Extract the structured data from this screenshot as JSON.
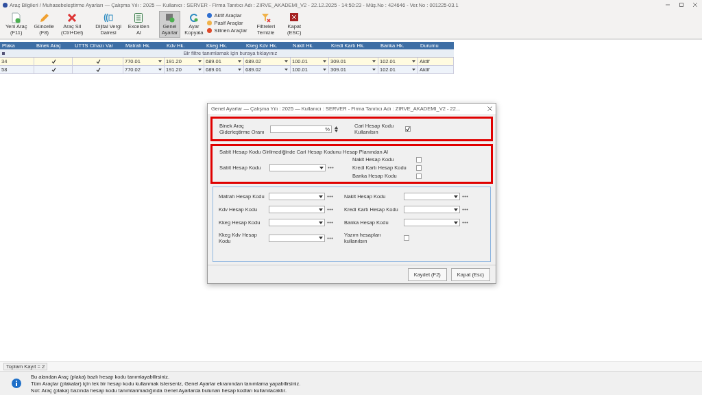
{
  "window": {
    "title": "Araç Bilgileri / Muhasebeleştirme Ayarları  —  Çalışma Yılı : 2025  —  Kullanıcı : SERVER - Firma Tanıtıcı Adı : ZIRVE_AKADEMI_V2 - 22.12.2025 - 14:50:23 - Müş.No : 424646 - Ver.No : 001225-03.1"
  },
  "toolbar": [
    {
      "kind": "new",
      "label": "Yeni Araç\n(F11)",
      "selected": false
    },
    {
      "kind": "edit",
      "label": "Güncelle\n(F8)",
      "selected": false
    },
    {
      "kind": "delete",
      "label": "Araç Sil\n(Ctrl+Del)",
      "selected": false
    },
    {
      "kind": "tax",
      "label": "Dijital Vergi\nDairesi",
      "selected": false
    },
    {
      "kind": "excel",
      "label": "Excelden\nAl",
      "selected": false
    },
    {
      "kind": "settings",
      "label": "Genel\nAyarlar",
      "selected": true
    },
    {
      "kind": "copy",
      "label": "Ayar\nKopyala",
      "selected": false
    },
    {
      "kind": "filters",
      "items": [
        {
          "label": "Aktif Araçlar",
          "color": "#2f6fd0"
        },
        {
          "label": "Pasif Araçlar",
          "color": "#f0b24a"
        },
        {
          "label": "Silinen Araçlar",
          "color": "#e04a2a"
        }
      ]
    },
    {
      "kind": "clear",
      "label": "Filtreleri\nTemizle",
      "selected": false
    },
    {
      "kind": "close",
      "label": "Kapat\n(ESC)",
      "selected": false
    }
  ],
  "grid": {
    "columns": [
      "Plaka",
      "Binek Araç",
      "UTTS Cihazı Var",
      "Matrah Hk.",
      "Kdv Hk.",
      "Kkeg Hk.",
      "Kkeg Kdv Hk.",
      "Nakit Hk.",
      "Kredi Kartı Hk.",
      "Banka Hk.",
      "Durumu"
    ],
    "filter_hint": "Bir filtre tanımlamak için buraya tıklayınız",
    "rows": [
      {
        "selected": true,
        "plaka": "34",
        "binek": true,
        "utts": true,
        "accounts": [
          "770.01",
          "191.20",
          "689.01",
          "689.02",
          "100.01",
          "309.01",
          "102.01"
        ],
        "status": "Aktif"
      },
      {
        "selected": false,
        "plaka": "58",
        "binek": true,
        "utts": true,
        "accounts": [
          "770.02",
          "191.20",
          "689.01",
          "689.02",
          "100.01",
          "309.01",
          "102.01"
        ],
        "status": "Aktif"
      }
    ]
  },
  "footer": {
    "record_count": "Toplam Kayıt = 2"
  },
  "info": [
    "Bu alandan Araç (plaka) bazlı hesap kodu tanımlayabilirsiniz.",
    "Tüm Araçlar (plakalar) için tek bir hesap kodu kullanmak isterseniz, Genel Ayarlar ekranından tanımlama yapabilirsiniz.",
    "Not: Araç (plaka) bazında hesap kodu tanımlanmadığında Genel Ayarlarda bulunan hesap kodları kullanılacaktır."
  ],
  "dialog": {
    "title": "Genel Ayarlar  —  Çalışma Yılı : 2025  —  Kullanıcı : SERVER - Firma Tanıtıcı Adı : ZIRVE_AKADEMI_V2 - 22...",
    "rate": {
      "label": "Binek Araç Giderleştirme Oranı",
      "unit": "%"
    },
    "cari": {
      "label": "Cari Hesap Kodu Kullanılsın",
      "checked": true
    },
    "rate_highlighted": true,
    "sabit": {
      "title": "Sabit Hesap Kodu Girilmediğinde Cari Hesap Kodunu Hesap Planından Al",
      "label": "Sabit Hesap Kodu",
      "highlighted": true,
      "options": [
        {
          "label": "Nakit Hesap Kodu",
          "checked": false
        },
        {
          "label": "Kredi Kartı Hesap Kodu",
          "checked": false
        },
        {
          "label": "Banka Hesap Kodu",
          "checked": false
        }
      ]
    },
    "left_fields": [
      "Matrah Hesap Kodu",
      "Kdv Hesap Kodu",
      "Kkeg Hesap Kodu",
      "Kkeg Kdv Hesap Kodu"
    ],
    "right_fields": [
      "Nakit Hesap Kodu",
      "Kredi Kartı Hesap Kodu",
      "Banka Hesap Kodu"
    ],
    "yazim": {
      "label": "Yazım hesapları kullanılsın",
      "checked": false
    },
    "buttons": [
      "Kaydet (F2)",
      "Kapat (Esc)"
    ]
  }
}
